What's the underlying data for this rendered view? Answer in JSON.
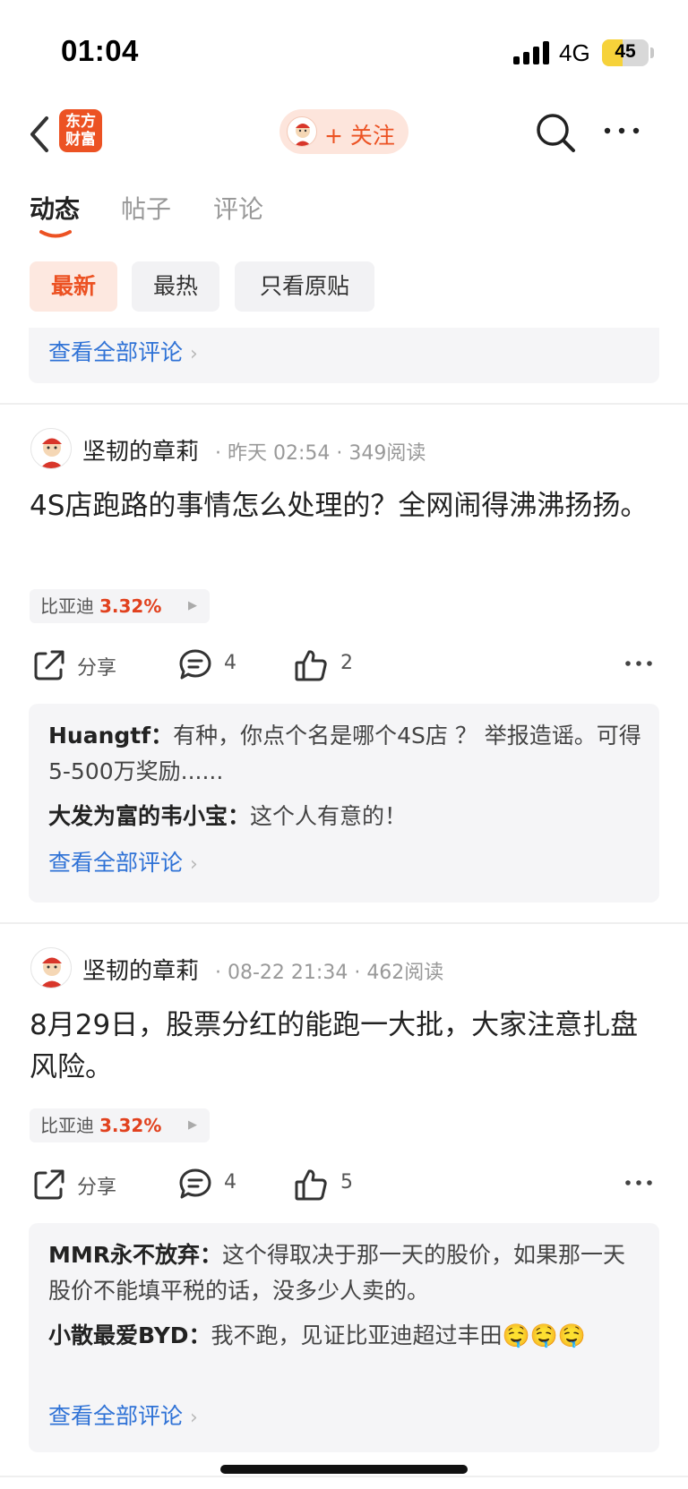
{
  "status": {
    "time": "01:04",
    "network": "4G",
    "battery": "45",
    "battery_level": 0.45
  },
  "nav": {
    "logo_text_1": "东方",
    "logo_text_2": "财富",
    "follow_label": "+ 关注"
  },
  "tabs": [
    {
      "label": "动态"
    },
    {
      "label": "帖子"
    },
    {
      "label": "评论"
    }
  ],
  "filters": [
    {
      "label": "最新"
    },
    {
      "label": "最热"
    },
    {
      "label": "只看原贴"
    }
  ],
  "top_comments": {
    "view_all": "查看全部评论"
  },
  "posts": [
    {
      "author": "坚韧的章莉",
      "time": "昨天 02:54",
      "reads": "349阅读",
      "content": "4S店跑路的事情怎么处理的？全网闹得沸沸扬扬。",
      "stock": {
        "name": "比亚迪",
        "change": "3.32%"
      },
      "actions": {
        "share": "分享",
        "comments": "4",
        "likes": "2"
      },
      "comments": [
        {
          "author": "Huangtf：",
          "text": "有种，你点个名是哪个4S店 ？ 举报造谣。可得5-500万奖励......"
        },
        {
          "author": "大发为富的韦小宝：",
          "text": "这个人有意的！"
        }
      ],
      "view_all": "查看全部评论"
    },
    {
      "author": "坚韧的章莉",
      "time": "08-22 21:34",
      "reads": "462阅读",
      "content": "8月29日，股票分红的能跑一大批，大家注意扎盘风险。",
      "stock": {
        "name": "比亚迪",
        "change": "3.32%"
      },
      "actions": {
        "share": "分享",
        "comments": "4",
        "likes": "5"
      },
      "comments": [
        {
          "author": "MMR永不放弃：",
          "text": "这个得取决于那一天的股价，如果那一天股价不能填平税的话，没多少人卖的。"
        },
        {
          "author": "小散最爱BYD：",
          "text": "我不跑，见证比亚迪超过丰田🤤🤤🤤"
        }
      ],
      "view_all": "查看全部评论"
    }
  ],
  "colors": {
    "brand": "#ec5223",
    "link": "#2f72d6",
    "up": "#e1411e"
  }
}
